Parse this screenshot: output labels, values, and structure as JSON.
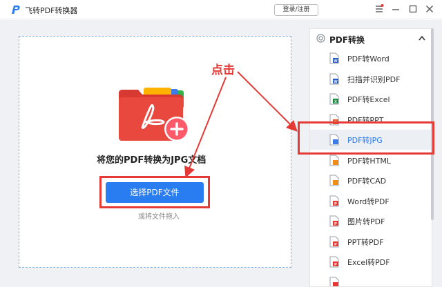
{
  "app": {
    "title": "飞转PDF转换器",
    "login_label": "登录/注册",
    "logo_letter": "P"
  },
  "window_controls": [
    "menu-icon",
    "minimize-icon",
    "maximize-icon",
    "close-icon"
  ],
  "main": {
    "title": "将您的PDF转换为JPG文档",
    "select_button": "选择PDF文件",
    "drag_hint": "或将文件拖入"
  },
  "annotation": {
    "text": "点击",
    "color": "#e53935"
  },
  "sidebar": {
    "group_title": "PDF转换",
    "items": [
      {
        "label": "PDF转Word",
        "icon": "word-doc-icon",
        "badge": "W",
        "color": "#2b5cbf",
        "active": false
      },
      {
        "label": "扫描并识别PDF",
        "icon": "scan-doc-icon",
        "badge": "W",
        "color": "#2b5cbf",
        "active": false
      },
      {
        "label": "PDF转Excel",
        "icon": "excel-doc-icon",
        "badge": "X",
        "color": "#1e8a44",
        "active": false
      },
      {
        "label": "PDF转PPT",
        "icon": "ppt-doc-icon",
        "badge": "P",
        "color": "#e2572b",
        "active": false
      },
      {
        "label": "PDF转JPG",
        "icon": "jpg-doc-icon",
        "badge": "",
        "color": "#3a7de6",
        "active": true
      },
      {
        "label": "PDF转HTML",
        "icon": "html-doc-icon",
        "badge": "",
        "color": "#f08c1a",
        "active": false
      },
      {
        "label": "PDF转CAD",
        "icon": "cad-doc-icon",
        "badge": "",
        "color": "#f08c1a",
        "active": false
      },
      {
        "label": "Word转PDF",
        "icon": "pdf-doc-icon",
        "badge": "P",
        "color": "#e53935",
        "active": false
      },
      {
        "label": "图片转PDF",
        "icon": "pdf-doc-icon",
        "badge": "P",
        "color": "#e53935",
        "active": false
      },
      {
        "label": "PPT转PDF",
        "icon": "pdf-doc-icon",
        "badge": "P",
        "color": "#e53935",
        "active": false
      },
      {
        "label": "Excel转PDF",
        "icon": "pdf-doc-icon",
        "badge": "P",
        "color": "#e53935",
        "active": false
      },
      {
        "label": "",
        "icon": "pdf-doc-icon",
        "badge": "",
        "color": "#e53935",
        "active": false
      }
    ]
  },
  "colors": {
    "accent": "#2a7df0",
    "annotation_red": "#e53935",
    "folder_red": "#e8443a"
  }
}
